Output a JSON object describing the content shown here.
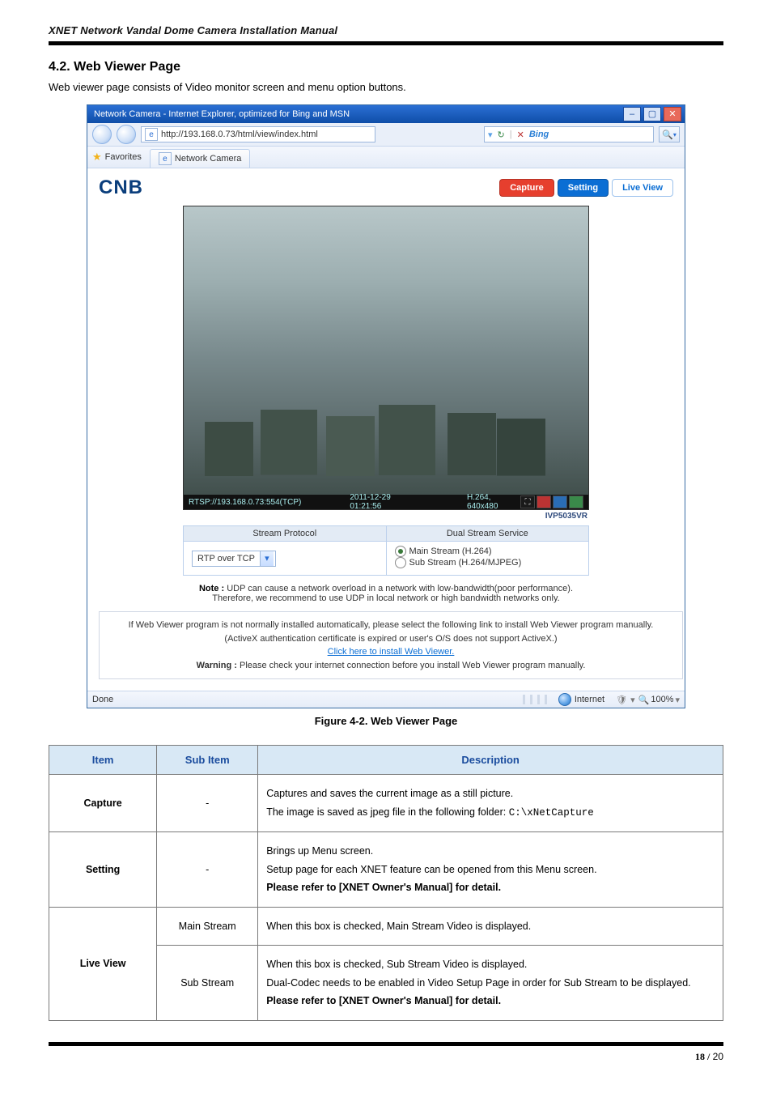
{
  "manual_title": "XNET Network Vandal Dome Camera Installation Manual",
  "section_heading": "4.2. Web Viewer Page",
  "intro_text": "Web viewer page consists of Video monitor screen and menu option buttons.",
  "figure_caption": "Figure 4-2. Web Viewer Page",
  "browser": {
    "window_title": "Network Camera - Internet Explorer, optimized for Bing and MSN",
    "url": "http://193.168.0.73/html/view/index.html",
    "search_placeholder": "Bing",
    "favorites_label": "Favorites",
    "tab_label": "Network Camera",
    "logo_text": "CNB",
    "buttons": {
      "capture": "Capture",
      "setting": "Setting",
      "live_view": "Live View"
    },
    "osd": {
      "rtsp": "RTSP://193.168.0.73:554(TCP)",
      "timestamp": "2011-12-29 01:21:56",
      "codec": "H.264, 640x480"
    },
    "model_label": "IVP5035VR",
    "stream_table": {
      "header_protocol": "Stream Protocol",
      "header_dual": "Dual Stream Service",
      "protocol_value": "RTP over TCP",
      "main_stream_label": "Main Stream (H.264)",
      "sub_stream_label": "Sub Stream (H.264/MJPEG)"
    },
    "note_bold": "Note :",
    "note_line1": "UDP can cause a network overload in a network with low-bandwidth(poor performance).",
    "note_line2": "Therefore, we recommend to use UDP in local network or high bandwidth networks only.",
    "warn": {
      "line1": "If Web Viewer program is not normally installed automatically, please select the following link to install Web Viewer program manually.",
      "line2": "(ActiveX authentication certificate is expired or user's O/S does not support ActiveX.)",
      "link": "Click here to install Web Viewer.",
      "line3_bold": "Warning :",
      "line3_rest": "Please check your internet connection before you install Web Viewer program manually."
    },
    "status": {
      "done": "Done",
      "zone": "Internet",
      "zoom": "100%"
    }
  },
  "table": {
    "headers": {
      "item": "Item",
      "sub": "Sub Item",
      "desc": "Description"
    },
    "rows": {
      "capture": {
        "item": "Capture",
        "sub": "-",
        "line1": "Captures and saves the current image as a still picture.",
        "line2_pre": "The image is saved as jpeg file in the following folder: ",
        "line2_mono": "C:\\xNetCapture"
      },
      "setting": {
        "item": "Setting",
        "sub": "-",
        "line1": "Brings up Menu screen.",
        "line2": "Setup page for each XNET feature can be opened from this Menu screen.",
        "line3": "Please refer to [XNET Owner's Manual] for detail."
      },
      "live_view": {
        "item": "Live View",
        "main": {
          "sub": "Main Stream",
          "desc": "When this box is checked, Main Stream Video is displayed."
        },
        "subs": {
          "sub": "Sub Stream",
          "line1": "When this box is checked, Sub Stream Video is displayed.",
          "line2": "Dual-Codec needs to be enabled in Video Setup Page in order for Sub Stream to be displayed.",
          "line3": "Please refer to [XNET Owner's Manual] for detail."
        }
      }
    }
  },
  "footer": {
    "page_bold": "18 /",
    "page_total": " 20"
  }
}
